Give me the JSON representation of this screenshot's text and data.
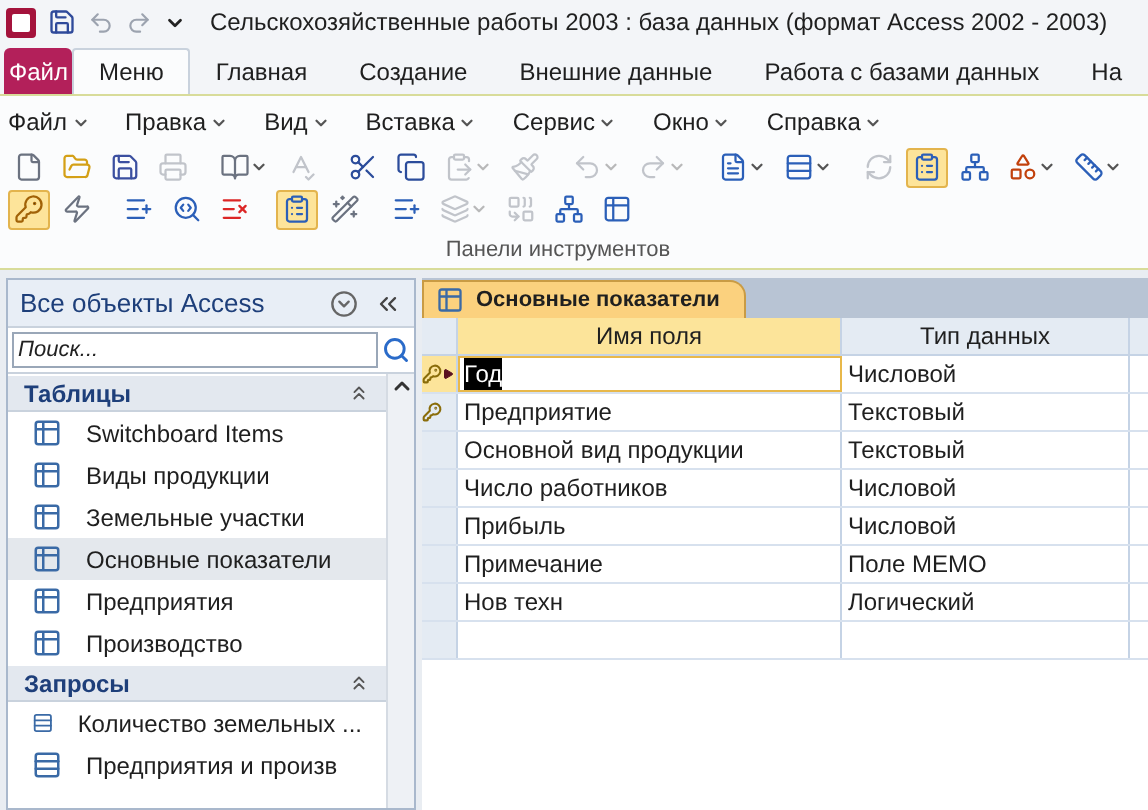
{
  "window": {
    "title": "Сельскохозяйственные работы 2003 : база данных (формат Access 2002 - 2003)"
  },
  "ribbon_tabs": [
    {
      "label": "Файл",
      "kind": "file",
      "selected": false
    },
    {
      "label": "Меню",
      "kind": "tab",
      "selected": true
    },
    {
      "label": "Главная",
      "kind": "tab",
      "selected": false
    },
    {
      "label": "Создание",
      "kind": "tab",
      "selected": false
    },
    {
      "label": "Внешние данные",
      "kind": "tab",
      "selected": false
    },
    {
      "label": "Работа с базами данных",
      "kind": "tab",
      "selected": false
    },
    {
      "label": "На",
      "kind": "tab",
      "selected": false
    }
  ],
  "menu": [
    {
      "label": "Файл"
    },
    {
      "label": "Правка"
    },
    {
      "label": "Вид"
    },
    {
      "label": "Вставка"
    },
    {
      "label": "Сервис"
    },
    {
      "label": "Окно"
    },
    {
      "label": "Справка"
    }
  ],
  "toolbar_rows": [
    [
      {
        "pressed": false,
        "disabled": false
      },
      {
        "pressed": false,
        "disabled": false
      },
      {
        "pressed": false,
        "disabled": false
      },
      {
        "pressed": false,
        "disabled": true
      },
      {
        "pressed": false,
        "disabled": false
      },
      {
        "pressed": false,
        "disabled": true
      },
      {
        "pressed": false,
        "disabled": false
      },
      {
        "pressed": false,
        "disabled": false
      },
      {
        "pressed": false,
        "disabled": true
      },
      {
        "pressed": false,
        "disabled": true
      },
      {
        "pressed": false,
        "disabled": true
      },
      {
        "pressed": false,
        "disabled": true
      },
      {
        "pressed": false,
        "disabled": false
      },
      {
        "pressed": false,
        "disabled": false
      },
      {
        "pressed": false,
        "disabled": true
      },
      {
        "pressed": true,
        "disabled": false
      },
      {
        "pressed": false,
        "disabled": false
      },
      {
        "pressed": false,
        "disabled": false
      },
      {
        "pressed": false,
        "disabled": false
      }
    ],
    [
      {
        "pressed": true,
        "disabled": false
      },
      {
        "pressed": false,
        "disabled": false
      },
      {
        "pressed": false,
        "disabled": false
      },
      {
        "pressed": false,
        "disabled": false
      },
      {
        "pressed": false,
        "disabled": false
      },
      {
        "pressed": true,
        "disabled": false
      },
      {
        "pressed": false,
        "disabled": false
      },
      {
        "pressed": false,
        "disabled": false
      },
      {
        "pressed": false,
        "disabled": true
      },
      {
        "pressed": false,
        "disabled": true
      },
      {
        "pressed": false,
        "disabled": false
      },
      {
        "pressed": false,
        "disabled": false
      }
    ]
  ],
  "group_label": "Панели инструментов",
  "nav": {
    "title": "Все объекты Access",
    "search": {
      "placeholder": "Поиск..."
    },
    "groups": [
      {
        "label": "Таблицы",
        "kind": "table",
        "expanded": true,
        "items": [
          {
            "label": "Switchboard Items",
            "selected": false
          },
          {
            "label": "Виды продукции",
            "selected": false
          },
          {
            "label": "Земельные участки",
            "selected": false
          },
          {
            "label": "Основные показатели",
            "selected": true
          },
          {
            "label": "Предприятия",
            "selected": false
          },
          {
            "label": "Производство",
            "selected": false
          }
        ]
      },
      {
        "label": "Запросы",
        "kind": "query",
        "expanded": true,
        "items": [
          {
            "label": "Количество земельных ...",
            "selected": false
          },
          {
            "label": "Предприятия и произв",
            "selected": false
          }
        ]
      }
    ]
  },
  "document": {
    "tab": {
      "label": "Основные показатели",
      "selected": true
    },
    "columns": [
      {
        "label": "Имя поля",
        "selected": true
      },
      {
        "label": "Тип данных",
        "selected": false
      }
    ],
    "rows": [
      {
        "field": "Год",
        "type": "Числовой",
        "key": true,
        "current": true
      },
      {
        "field": "Предприятие",
        "type": "Текстовый",
        "key": true,
        "current": false
      },
      {
        "field": "Основной вид продукции",
        "type": "Текстовый",
        "key": false,
        "current": false
      },
      {
        "field": "Число работников",
        "type": "Числовой",
        "key": false,
        "current": false
      },
      {
        "field": "Прибыль",
        "type": "Числовой",
        "key": false,
        "current": false
      },
      {
        "field": "Примечание",
        "type": "Поле MEMO",
        "key": false,
        "current": false
      },
      {
        "field": "Нов техн",
        "type": "Логический",
        "key": false,
        "current": false
      }
    ]
  }
}
